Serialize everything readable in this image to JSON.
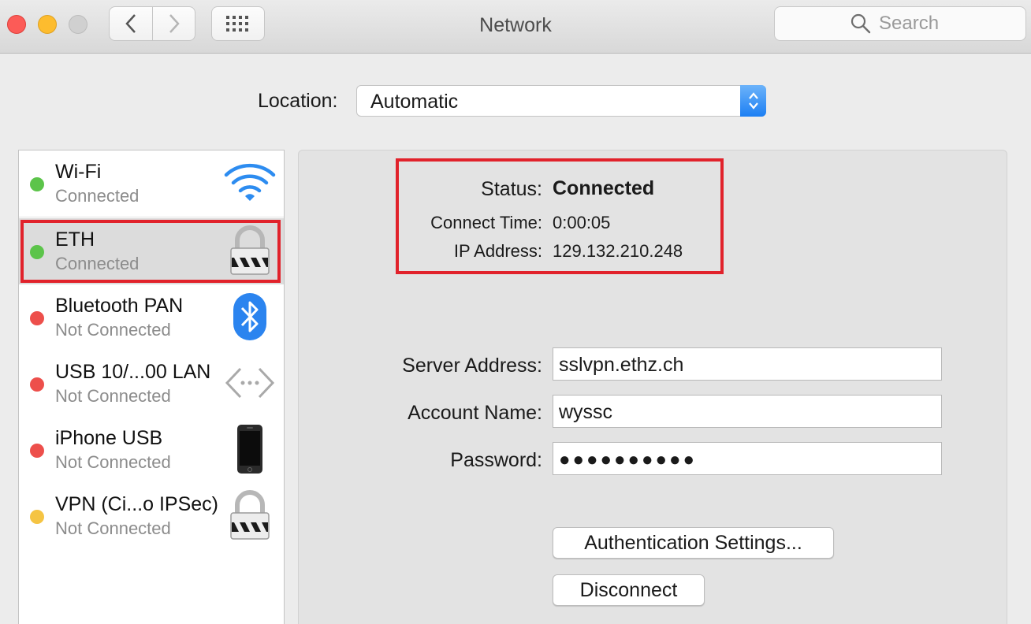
{
  "window": {
    "title": "Network"
  },
  "search": {
    "placeholder": "Search"
  },
  "location": {
    "label": "Location:",
    "value": "Automatic"
  },
  "services": [
    {
      "name": "Wi-Fi",
      "status": "Connected",
      "dot": "#5cc44a",
      "icon": "wifi-icon",
      "selected": false
    },
    {
      "name": "ETH",
      "status": "Connected",
      "dot": "#5cc44a",
      "icon": "lock-icon",
      "selected": true
    },
    {
      "name": "Bluetooth PAN",
      "status": "Not Connected",
      "dot": "#ed4f4b",
      "icon": "bluetooth-icon",
      "selected": false
    },
    {
      "name": "USB 10/...00 LAN",
      "status": "Not Connected",
      "dot": "#ed4f4b",
      "icon": "ethernet-icon",
      "selected": false
    },
    {
      "name": "iPhone USB",
      "status": "Not Connected",
      "dot": "#ed4f4b",
      "icon": "iphone-icon",
      "selected": false
    },
    {
      "name": "VPN (Ci...o IPSec)",
      "status": "Not Connected",
      "dot": "#f5c443",
      "icon": "lock-icon",
      "selected": false
    }
  ],
  "status_panel": {
    "status_label": "Status:",
    "status_value": "Connected",
    "connect_time_label": "Connect Time:",
    "connect_time_value": "0:00:05",
    "ip_label": "IP Address:",
    "ip_value": "129.132.210.248"
  },
  "form": {
    "server_label": "Server Address:",
    "server_value": "sslvpn.ethz.ch",
    "account_label": "Account Name:",
    "account_value": "wyssc",
    "password_label": "Password:",
    "password_value": "●●●●●●●●●●"
  },
  "buttons": {
    "auth_settings": "Authentication Settings...",
    "disconnect": "Disconnect"
  },
  "colors": {
    "highlight_frame": "#e1222b",
    "accent": "#1c7ff3"
  }
}
